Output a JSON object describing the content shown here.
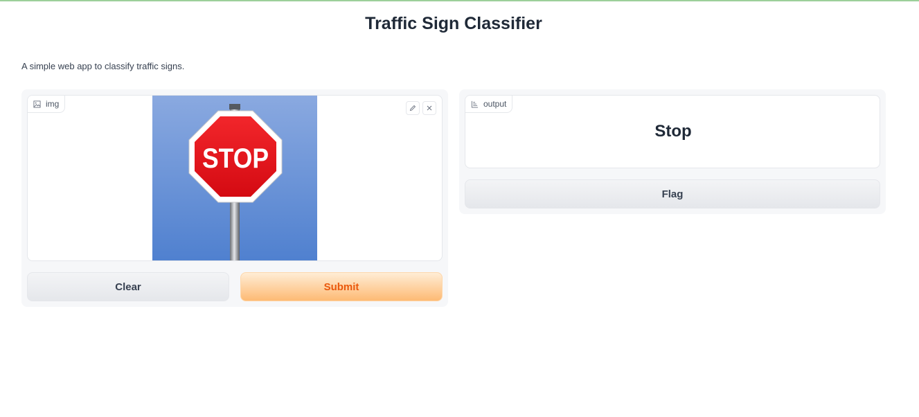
{
  "app": {
    "title": "Traffic Sign Classifier",
    "description": "A simple web app to classify traffic signs."
  },
  "input": {
    "label": "img",
    "image_sign_text": "STOP",
    "icons": {
      "label": "image-icon",
      "edit": "pencil-icon",
      "clear": "close-icon"
    }
  },
  "output": {
    "label": "output",
    "value": "Stop",
    "icon": "label-icon"
  },
  "buttons": {
    "clear": "Clear",
    "submit": "Submit",
    "flag": "Flag"
  },
  "colors": {
    "accent": "#ea580c",
    "sign_red": "#e8141b",
    "sky_blue": "#6a95d8"
  }
}
